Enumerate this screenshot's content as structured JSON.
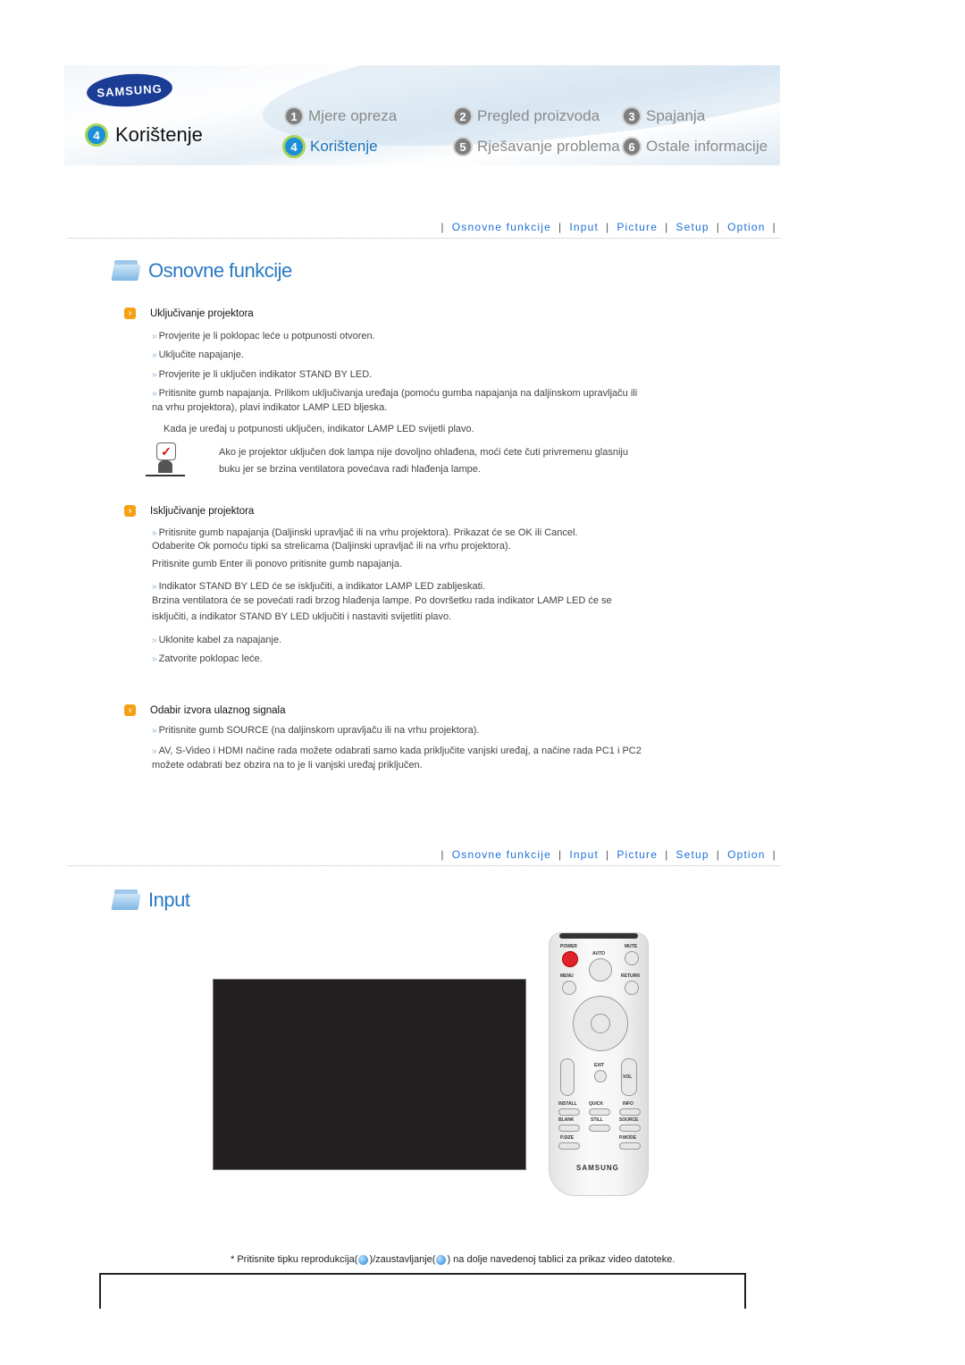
{
  "header": {
    "brand": "SAMSUNG",
    "current_section": {
      "number": "4",
      "label": "Korištenje"
    },
    "nav": [
      {
        "number": "1",
        "label": "Mjere opreza",
        "active": false
      },
      {
        "number": "2",
        "label": "Pregled proizvoda",
        "active": false
      },
      {
        "number": "3",
        "label": "Spajanja",
        "active": false
      },
      {
        "number": "4",
        "label": "Korištenje",
        "active": true
      },
      {
        "number": "5",
        "label": "Rješavanje problema",
        "active": false
      },
      {
        "number": "6",
        "label": "Ostale informacije",
        "active": false
      }
    ]
  },
  "subnav": {
    "separator": "|",
    "links": [
      "Osnovne funkcije",
      "Input",
      "Picture",
      "Setup",
      "Option"
    ]
  },
  "sections": {
    "basic": {
      "title": "Osnovne funkcije",
      "power_on": {
        "heading": "Uključivanje projektora",
        "items": [
          "Provjerite je li poklopac leće u potpunosti otvoren.",
          "Uključite napajanje.",
          "Provjerite je li uključen indikator STAND BY LED.",
          "Pritisnite gumb napajanja. Prilikom uključivanja uređaja (pomoću gumba napajanja na daljinskom upravljaču ili",
          "na vrhu projektora), plavi indikator LAMP LED bljeska."
        ],
        "after": "Kada je uređaj u potpunosti uključen, indikator LAMP LED svijetli plavo.",
        "note_line1": "Ako je projektor uključen dok lampa nije dovoljno ohlađena, moći ćete čuti privremenu glasniju",
        "note_line2": "buku jer se brzina ventilatora povećava radi hlađenja lampe."
      },
      "power_off": {
        "heading": "Isključivanje projektora",
        "item1_l1": "Pritisnite gumb napajanja (Daljinski upravljač ili na vrhu projektora). Prikazat će se OK ili Cancel.",
        "item1_l2": "Odaberite Ok pomoću tipki sa strelicama (Daljinski upravljač ili na vrhu projektora).",
        "item1_l3": "Pritisnite gumb Enter ili ponovo pritisnite gumb napajanja.",
        "item2_l1": "Indikator STAND BY LED će se isključiti, a indikator LAMP LED zabljeskati.",
        "item2_l2": "Brzina ventilatora će se povećati radi brzog hlađenja lampe. Po dovršetku rada indikator LAMP LED će se",
        "item2_l3": "isključiti, a indikator STAND BY LED uključiti i nastaviti svijetliti plavo.",
        "item3": "Uklonite kabel za napajanje.",
        "item4": "Zatvorite poklopac leće."
      },
      "source": {
        "heading": "Odabir izvora ulaznog signala",
        "item1": "Pritisnite gumb SOURCE (na daljinskom upravljaču ili na vrhu projektora).",
        "item2_l1": "AV, S-Video i HDMI načine rada možete odabrati samo kada priključite vanjski uređaj, a načine rada PC1 i PC2",
        "item2_l2": "možete odabrati bez obzira na to je li vanjski uređaj priključen."
      }
    },
    "input": {
      "title": "Input",
      "remote": {
        "labels": [
          "POWER",
          "AUTO",
          "MUTE",
          "MENU",
          "RETURN",
          "EXIT",
          "VOL",
          "INSTALL",
          "QUICK",
          "INFO",
          "BLANK",
          "STILL",
          "SOURCE",
          "P.SIZE",
          "P.MODE"
        ],
        "brand": "SAMSUNG"
      },
      "footnote_a": "* Pritisnite tipku reprodukcija(",
      "footnote_b": ")/zaustavljanje(",
      "footnote_c": ") na dolje navedenoj tablici za prikaz video datoteke."
    }
  },
  "icons": {
    "bullet": "arrow-right-icon",
    "item_marker": "double-chevron-icon",
    "play": "play-icon",
    "stop": "stop-icon"
  }
}
